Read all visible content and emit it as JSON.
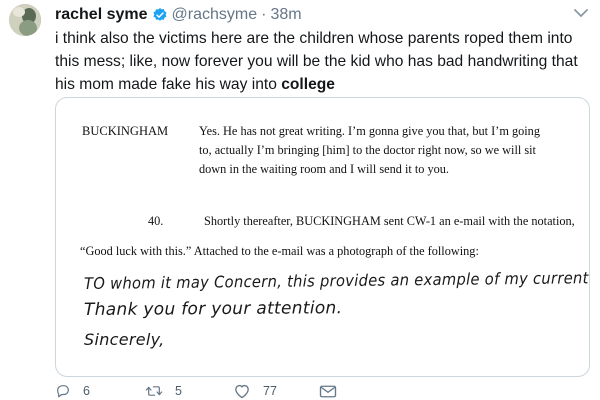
{
  "user": {
    "name": "rachel syme",
    "handle": "@rachsyme",
    "time": "38m"
  },
  "tweet": {
    "text_part1": "i think also the victims here are the children whose parents roped them into this mess; like, now forever you will be the kid who has bad handwriting that his mom made fake his way into ",
    "text_bold": "college"
  },
  "document": {
    "speaker": "BUCKINGHAM",
    "quote_lines": [
      "Yes. He has not great writing.  I’m gonna give you that, but I’m going",
      "to, actually I’m bringing [him] to the doctor right now, so we will sit",
      "down in the waiting room and I will send it to you."
    ],
    "para_number": "40.",
    "para_line1": "Shortly thereafter, BUCKINGHAM sent CW-1 an e-mail with the notation,",
    "para_line2": "“Good luck with this.”  Attached to the e-mail was a photograph of the following:",
    "handwriting": [
      "TO whom it may Concern, this provides an example of my current writing Styte.",
      "Thank you for your attention.",
      "Sincerely,"
    ]
  },
  "actions": {
    "replies": "6",
    "retweets": "5",
    "likes": "77"
  },
  "colors": {
    "verified": "#1da1f2",
    "muted": "#657786",
    "border": "#ccd6dd"
  },
  "icons": {
    "verified": "verified-badge-icon",
    "caret": "chevron-down-icon",
    "reply": "reply-icon",
    "retweet": "retweet-icon",
    "like": "heart-icon",
    "dm": "envelope-icon"
  }
}
